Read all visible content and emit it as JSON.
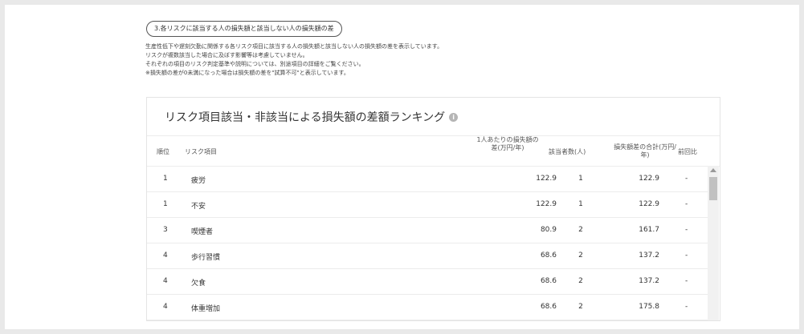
{
  "section": {
    "pill_label": "3.各リスクに該当する人の損失額と該当しない人の損失額の差"
  },
  "description": [
    "生産性低下や遅刻欠勤に関係する各リスク項目に該当する人の損失額と該当しない人の損失額の差を表示しています。",
    "リスクが複数該当した場合に及ぼす影響等は考慮していません。",
    "それぞれの項目のリスク判定基準や説明については、別途項目の詳細をご覧ください。",
    "※損失額の差が0未満になった場合は損失額の差を\"試算不可\"と表示しています。"
  ],
  "card": {
    "title": "リスク項目該当・非該当による損失額の差額ランキング",
    "info_icon": "i"
  },
  "table": {
    "headers": {
      "rank": "順位",
      "item": "リスク項目",
      "diff": "1人あたりの損失額の差(万円/年)",
      "count": "該当者数(人)",
      "total": "損失額差の合計(万円/年)",
      "prev": "前回比"
    },
    "rows": [
      {
        "rank": "1",
        "item": "疲労",
        "diff": "122.9",
        "count": "1",
        "total": "122.9",
        "prev": "-"
      },
      {
        "rank": "1",
        "item": "不安",
        "diff": "122.9",
        "count": "1",
        "total": "122.9",
        "prev": "-"
      },
      {
        "rank": "3",
        "item": "喫煙者",
        "diff": "80.9",
        "count": "2",
        "total": "161.7",
        "prev": "-"
      },
      {
        "rank": "4",
        "item": "歩行習慣",
        "diff": "68.6",
        "count": "2",
        "total": "137.2",
        "prev": "-"
      },
      {
        "rank": "4",
        "item": "欠食",
        "diff": "68.6",
        "count": "2",
        "total": "137.2",
        "prev": "-"
      },
      {
        "rank": "4",
        "item": "体重増加",
        "diff": "68.6",
        "count": "2",
        "total": "175.8",
        "prev": "-"
      }
    ]
  }
}
